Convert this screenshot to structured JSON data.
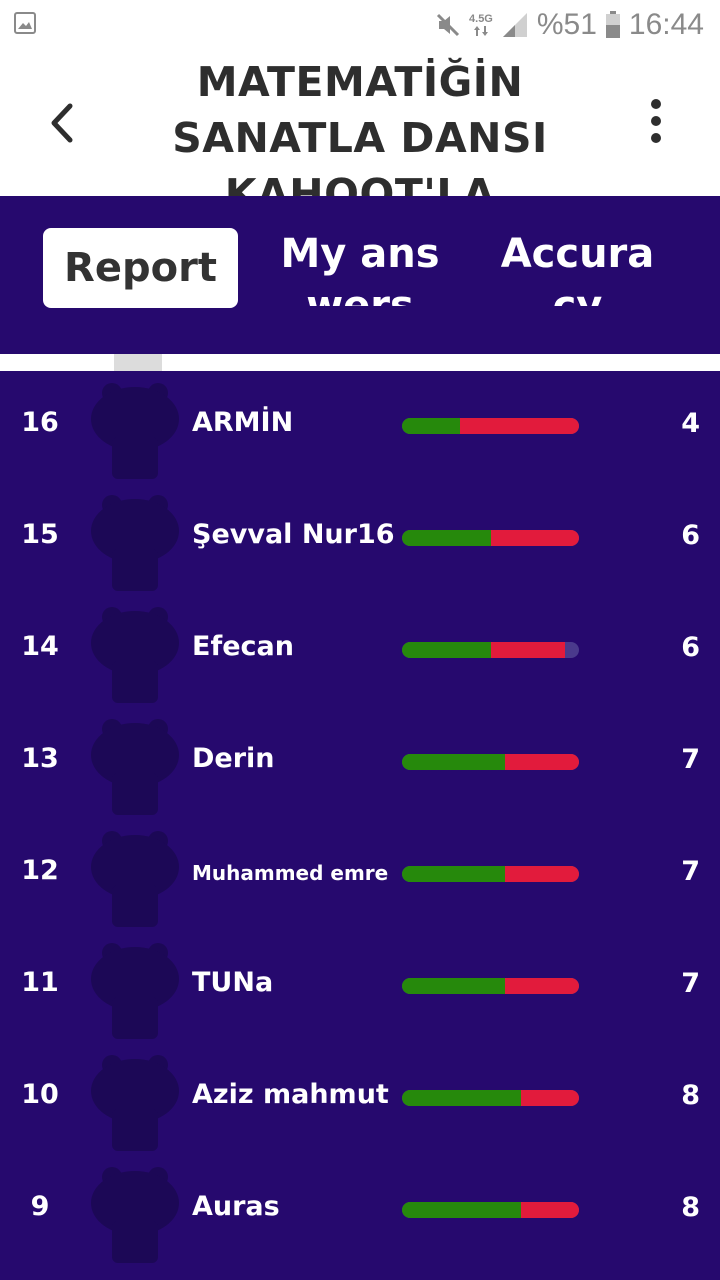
{
  "status_bar": {
    "network": "4.5G",
    "battery": "%51",
    "time": "16:44"
  },
  "header": {
    "title": "MATEMATİĞİN SANATLA DANSI KAHOOT'LA"
  },
  "tabs": [
    {
      "label": "Report",
      "selected": true
    },
    {
      "label": "My answers",
      "selected": false
    },
    {
      "label": "Accuracy",
      "selected": false
    }
  ],
  "colors": {
    "brand_purple": "#26096e",
    "correct_green": "#26890c",
    "incorrect_red": "#e21b3c"
  },
  "players": [
    {
      "rank": "16",
      "name": "ARMİN",
      "score": "4",
      "correct_fraction": 0.33,
      "incorrect_fraction": 0.67
    },
    {
      "rank": "15",
      "name": "Şevval Nur16",
      "score": "6",
      "correct_fraction": 0.5,
      "incorrect_fraction": 0.5
    },
    {
      "rank": "14",
      "name": "Efecan",
      "score": "6",
      "correct_fraction": 0.5,
      "incorrect_fraction": 0.42
    },
    {
      "rank": "13",
      "name": "Derin",
      "score": "7",
      "correct_fraction": 0.58,
      "incorrect_fraction": 0.42
    },
    {
      "rank": "12",
      "name": "Muhammed emre",
      "score": "7",
      "correct_fraction": 0.58,
      "incorrect_fraction": 0.42,
      "small": true
    },
    {
      "rank": "11",
      "name": "TUNa",
      "score": "7",
      "correct_fraction": 0.58,
      "incorrect_fraction": 0.42
    },
    {
      "rank": "10",
      "name": "Aziz mahmut",
      "score": "8",
      "correct_fraction": 0.67,
      "incorrect_fraction": 0.33
    },
    {
      "rank": "9",
      "name": "Auras",
      "score": "8",
      "correct_fraction": 0.67,
      "incorrect_fraction": 0.33
    }
  ]
}
